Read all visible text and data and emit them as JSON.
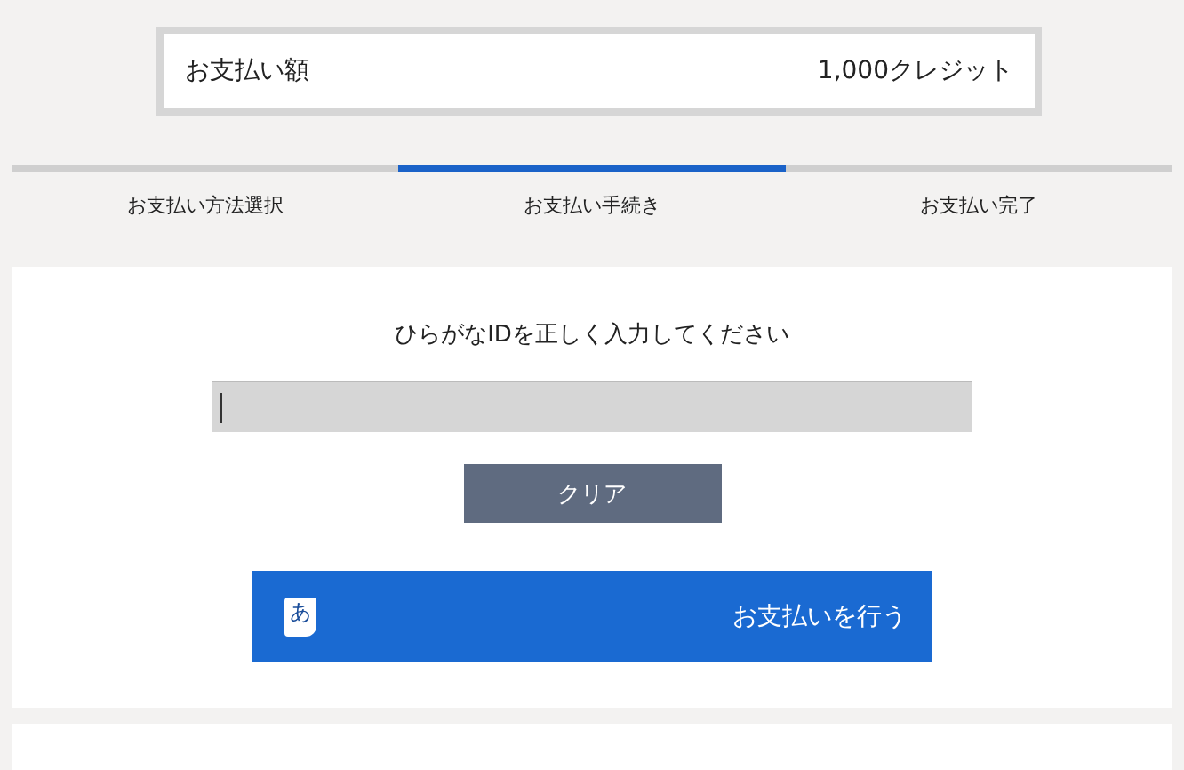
{
  "amount": {
    "label": "お支払い額",
    "value": "1,000クレジット"
  },
  "steps": [
    {
      "label": "お支払い方法選択",
      "selected": false
    },
    {
      "label": "お支払い手続き",
      "selected": true
    },
    {
      "label": "お支払い完了",
      "selected": false
    }
  ],
  "form": {
    "prompt": "ひらがなIDを正しく入力してください",
    "input": {
      "focused": true
    },
    "clear_button": "クリア",
    "pay_button": {
      "icon_char": "あ",
      "label": "お支払いを行う"
    }
  }
}
